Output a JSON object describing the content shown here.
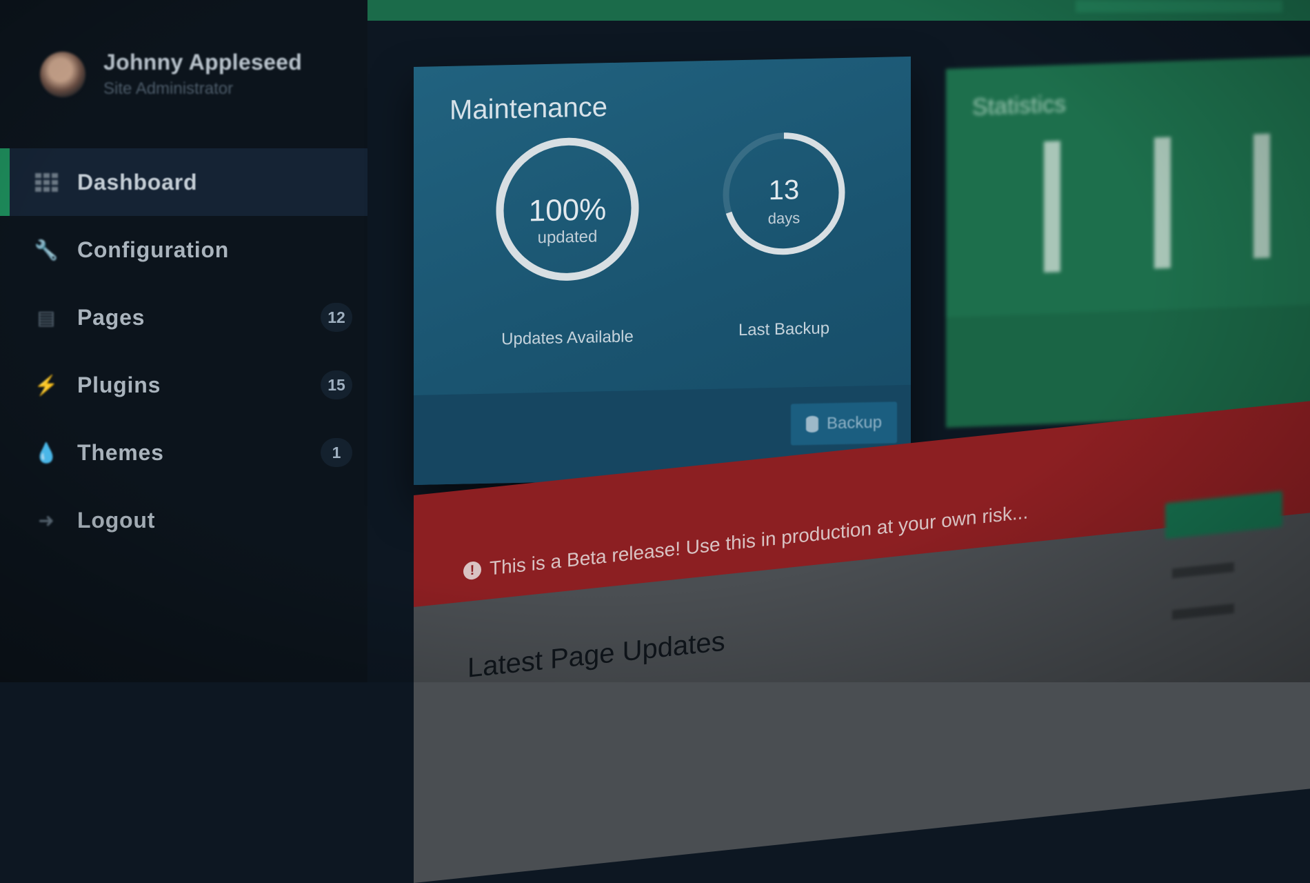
{
  "user": {
    "name": "Johnny Appleseed",
    "role": "Site Administrator"
  },
  "nav": {
    "items": [
      {
        "label": "Dashboard",
        "icon": "dashboard-grid-icon",
        "active": true
      },
      {
        "label": "Configuration",
        "icon": "wrench-icon"
      },
      {
        "label": "Pages",
        "icon": "file-icon",
        "badge": "12"
      },
      {
        "label": "Plugins",
        "icon": "plug-icon",
        "badge": "15"
      },
      {
        "label": "Themes",
        "icon": "droplet-icon",
        "badge": "1"
      },
      {
        "label": "Logout",
        "icon": "sign-out-icon"
      }
    ]
  },
  "maintenance": {
    "title": "Maintenance",
    "updates": {
      "value": "100%",
      "unit": "updated",
      "caption": "Updates Available",
      "fraction": 1.0
    },
    "backup": {
      "value": "13",
      "unit": "days",
      "caption": "Last Backup",
      "fraction": 0.7
    },
    "backup_button": "Backup"
  },
  "statistics": {
    "title": "Statistics"
  },
  "alert": {
    "text": "This is a Beta release! Use this in production at your own risk..."
  },
  "latest_updates": {
    "title": "Latest Page Updates"
  },
  "colors": {
    "accent": "#1d8a5a",
    "maintenance_bg": "#1a5470",
    "statistics_bg": "#1d6f4c",
    "alert_bg": "#8c1f22"
  }
}
